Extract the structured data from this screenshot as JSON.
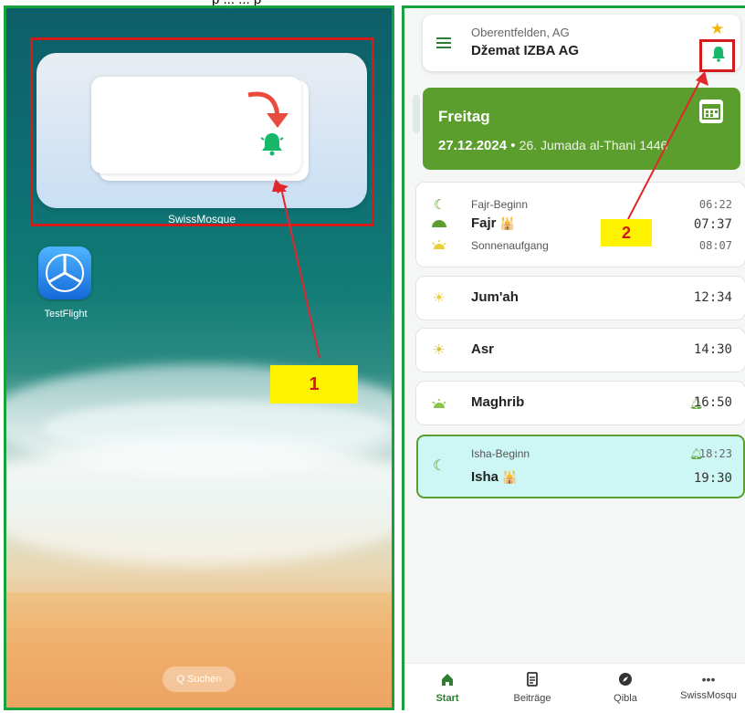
{
  "caption_fragment": "p ... ... p",
  "left_screen": {
    "widget_label": "SwissMosque",
    "app_icon_label": "TestFlight",
    "search_label": "Q Suchen",
    "annotation_number": "1"
  },
  "right_screen": {
    "location": {
      "city": "Oberentfelden, AG",
      "name": "Džemat IZBA AG"
    },
    "annotation_number": "2",
    "date_card": {
      "day": "Freitag",
      "date": "27.12.2024",
      "separator": " • ",
      "hijri": "26. Jumada al-Thani 1446"
    },
    "prayers": {
      "fajr_begin_label": "Fajr-Beginn",
      "fajr_begin_time": "06:22",
      "fajr_label": "Fajr",
      "fajr_time": "07:37",
      "sunrise_label": "Sonnenaufgang",
      "sunrise_time": "08:07",
      "jumah_label": "Jum'ah",
      "jumah_time": "12:34",
      "asr_label": "Asr",
      "asr_time": "14:30",
      "maghrib_label": "Maghrib",
      "maghrib_time": "16:50",
      "isha_begin_label": "Isha-Beginn",
      "isha_begin_time": "18:23",
      "isha_label": "Isha",
      "isha_time": "19:30"
    },
    "nav": [
      {
        "label": "Start",
        "icon": "home-icon"
      },
      {
        "label": "Beiträge",
        "icon": "document-icon"
      },
      {
        "label": "Qibla",
        "icon": "compass-icon"
      },
      {
        "label": "SwissMosqu",
        "icon": "more-icon"
      }
    ]
  },
  "colors": {
    "accent_green": "#5b9e2e",
    "annotation_red": "#d31b1b",
    "annotation_yellow": "#fff200",
    "frame_green": "#17a33b"
  }
}
